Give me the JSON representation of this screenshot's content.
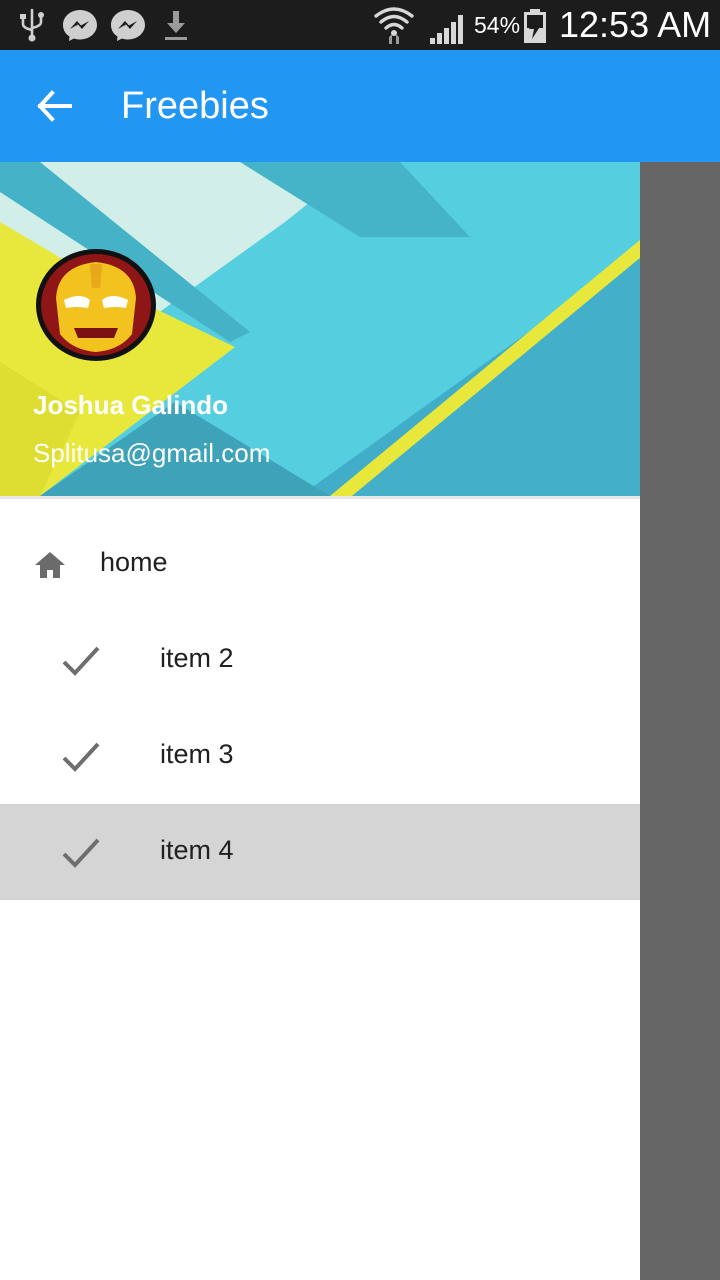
{
  "status_bar": {
    "battery_percent": "54%",
    "time": "12:53 AM",
    "icons": [
      "usb-icon",
      "messenger-icon",
      "messenger-icon",
      "download-icon",
      "wifi-icon",
      "signal-icon",
      "battery-charging-icon"
    ]
  },
  "app_bar": {
    "title": "Freebies",
    "back_icon": "arrow-back-icon",
    "color": "#2196f3"
  },
  "drawer": {
    "header": {
      "user_name": "Joshua Galindo",
      "user_email": "Splitusa@gmail.com",
      "avatar": "iron-man-avatar"
    },
    "items": [
      {
        "label": "home",
        "icon": "home-icon"
      },
      {
        "label": "item 2",
        "icon": "check-icon"
      },
      {
        "label": "item 3",
        "icon": "check-icon"
      },
      {
        "label": "item 4",
        "icon": "check-icon",
        "selected": true
      }
    ]
  }
}
